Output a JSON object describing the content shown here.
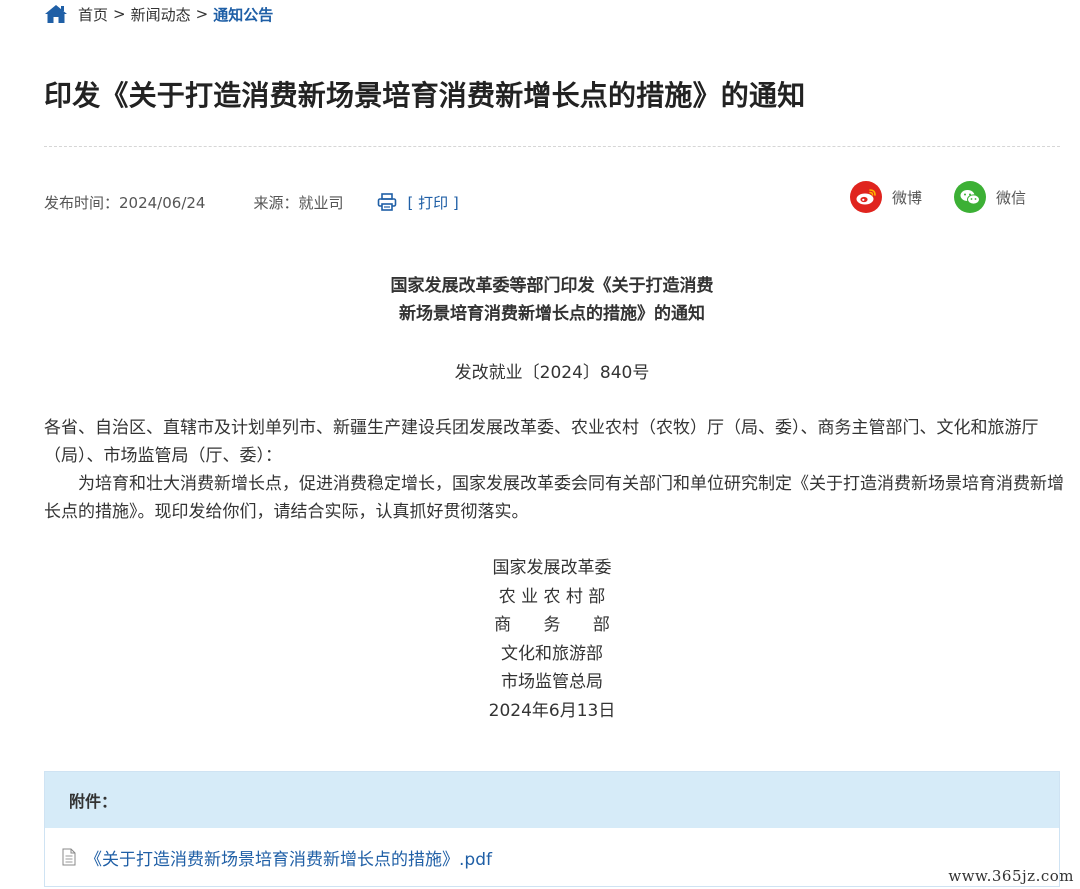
{
  "breadcrumb": {
    "home": "首页",
    "separator": ">",
    "section": "新闻动态",
    "current": "通知公告"
  },
  "article": {
    "title": "印发《关于打造消费新场景培育消费新增长点的措施》的通知",
    "publish_time": "发布时间：2024/06/24",
    "source": "来源：就业司",
    "print_label": "[ 打印 ]"
  },
  "share": {
    "weibo_label": "微博",
    "wechat_label": "微信"
  },
  "document": {
    "heading_line1": "国家发展改革委等部门印发《关于打造消费",
    "heading_line2": "新场景培育消费新增长点的措施》的通知",
    "number": "发改就业〔2024〕840号",
    "addressees": "各省、自治区、直辖市及计划单列市、新疆生产建设兵团发展改革委、农业农村（农牧）厅（局、委）、商务主管部门、文化和旅游厅（局）、市场监管局（厅、委）：",
    "paragraph": "为培育和壮大消费新增长点，促进消费稳定增长，国家发展改革委会同有关部门和单位研究制定《关于打造消费新场景培育消费新增长点的措施》。现印发给你们，请结合实际，认真抓好贯彻落实。",
    "signatures": [
      "国家发展改革委",
      "农 业 农 村 部",
      "商      务      部",
      "文化和旅游部",
      "市场监管总局"
    ],
    "date": "2024年6月13日"
  },
  "attachments": {
    "header": "附件：",
    "files": [
      "《关于打造消费新场景培育消费新增长点的措施》.pdf"
    ]
  },
  "watermark": "www.365jz.com",
  "colors": {
    "link_blue": "#1f5fa6",
    "weibo_red": "#e0241e",
    "wechat_green": "#3cb035",
    "attachment_header_bg": "#d6ebf8"
  },
  "icons": [
    "home-icon",
    "printer-icon",
    "weibo-icon",
    "wechat-icon",
    "file-icon"
  ]
}
